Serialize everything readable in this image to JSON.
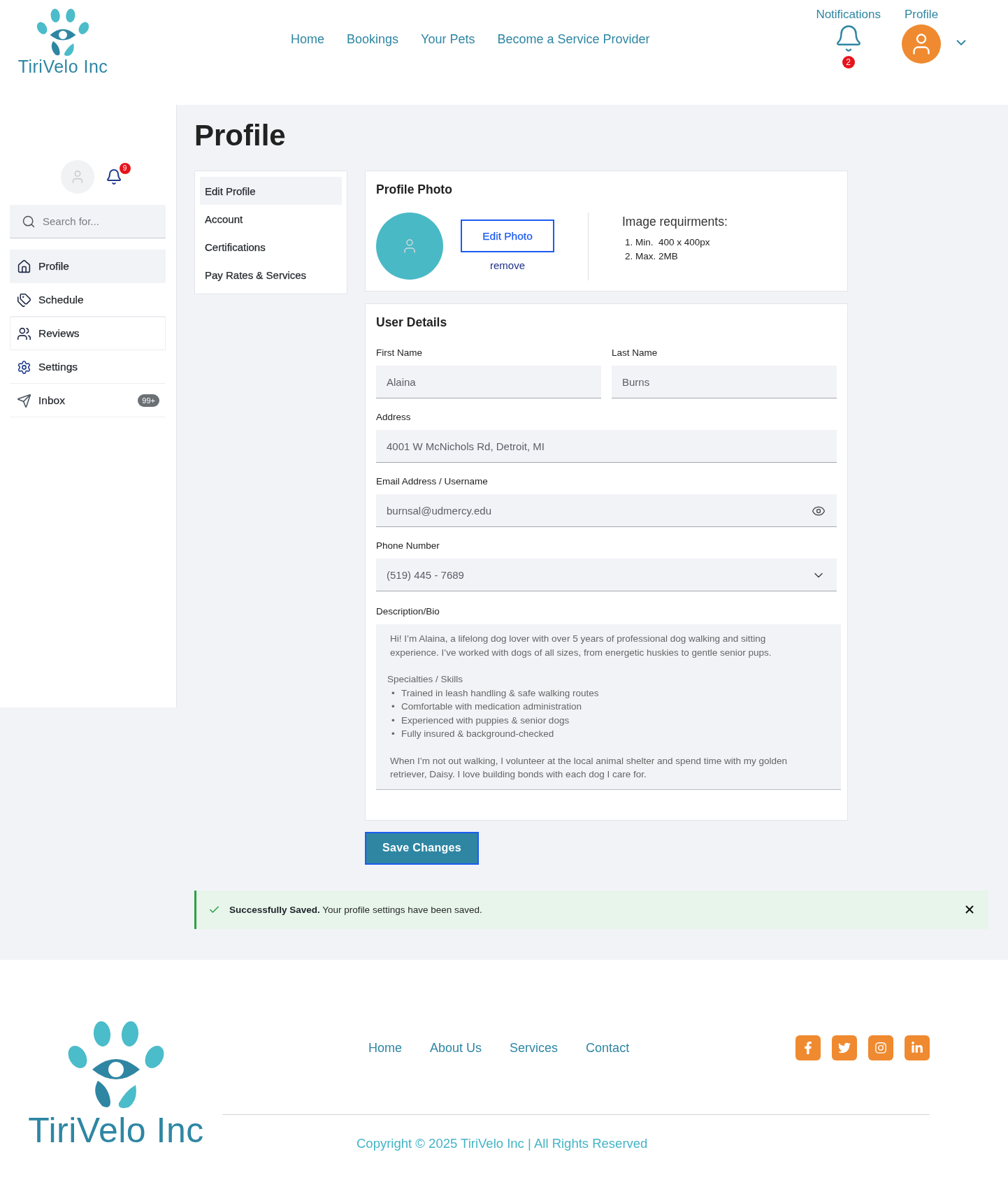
{
  "header": {
    "logo": {
      "name": "TiriVelo Inc"
    },
    "nav": [
      {
        "label": "Home"
      },
      {
        "label": "Bookings"
      },
      {
        "label": "Your Pets"
      },
      {
        "label": "Become a Service Provider"
      }
    ],
    "notifications": {
      "label": "Notifications",
      "count": "2"
    },
    "profile": {
      "label": "Profile"
    }
  },
  "sidebar": {
    "notifications": {
      "count": "9"
    },
    "search": {
      "placeholder": "Search for..."
    },
    "items": [
      {
        "label": "Profile",
        "selected": true,
        "hovered": false
      },
      {
        "label": "Schedule",
        "selected": false,
        "hovered": false
      },
      {
        "label": "Reviews",
        "selected": false,
        "hovered": true
      },
      {
        "label": "Settings",
        "selected": false,
        "hovered": false
      },
      {
        "label": "Inbox",
        "selected": false,
        "hovered": false,
        "badge": "99+"
      }
    ]
  },
  "page": {
    "title": "Profile"
  },
  "profile_menu": {
    "items": [
      {
        "label": "Edit Profile",
        "selected": true
      },
      {
        "label": "Account",
        "selected": false
      },
      {
        "label": "Certifications",
        "selected": false
      },
      {
        "label": "Pay Rates & Services",
        "selected": false
      }
    ]
  },
  "profile_photo": {
    "title": "Profile Photo",
    "edit_button": "Edit Photo",
    "remove_link": "remove",
    "requirements": {
      "title": "Image requirments:",
      "items": [
        "1. Min.  400 x 400px",
        "2. Max. 2MB"
      ]
    }
  },
  "user_details": {
    "title": "User Details",
    "rows": [
      {
        "fields": [
          {
            "kind": "text",
            "label": "First Name",
            "value": "Alaina"
          },
          {
            "kind": "text",
            "label": "Last Name",
            "value": "Burns"
          }
        ]
      },
      {
        "fields": [
          {
            "kind": "text",
            "label": "Address",
            "value": "4001 W McNichols Rd, Detroit, MI"
          }
        ]
      },
      {
        "fields": [
          {
            "kind": "reveal",
            "label": "Email Address / Username",
            "value": "burnsal@udmercy.edu"
          }
        ]
      },
      {
        "fields": [
          {
            "kind": "select",
            "label": "Phone Number",
            "value": "(519) 445 - 7689"
          }
        ]
      }
    ],
    "bio": {
      "label": "Description/Bio",
      "intro": "Hi! I’m Alaina, a lifelong dog lover with over 5 years of professional dog walking and sitting experience. I’ve worked with dogs of all sizes, from energetic huskies to gentle senior pups.",
      "skills_title": "Specialties / Skills",
      "skills": [
        {
          "bullet": "•",
          "text": "Trained in leash handling & safe walking routes"
        },
        {
          "bullet": "•",
          "text": "Comfortable with medication administration"
        },
        {
          "bullet": "•",
          "text": "Experienced with puppies & senior dogs"
        },
        {
          "bullet": "•",
          "text": "Fully insured & background-checked"
        }
      ],
      "outro": "When I’m not out walking, I volunteer at the local animal shelter and spend time with my golden retriever, Daisy. I love building bonds with each dog I care for."
    }
  },
  "save_button": {
    "label": "Save Changes"
  },
  "alert": {
    "message": "**Successfully Saved.** Your profile settings have been saved."
  },
  "footer": {
    "logo": {
      "name": "TiriVelo Inc"
    },
    "nav": [
      {
        "label": "Home"
      },
      {
        "label": "About Us"
      },
      {
        "label": "Services"
      },
      {
        "label": "Contact"
      }
    ],
    "copyright": "Copyright © 2025 TiriVelo Inc | All Rights Reserved"
  }
}
